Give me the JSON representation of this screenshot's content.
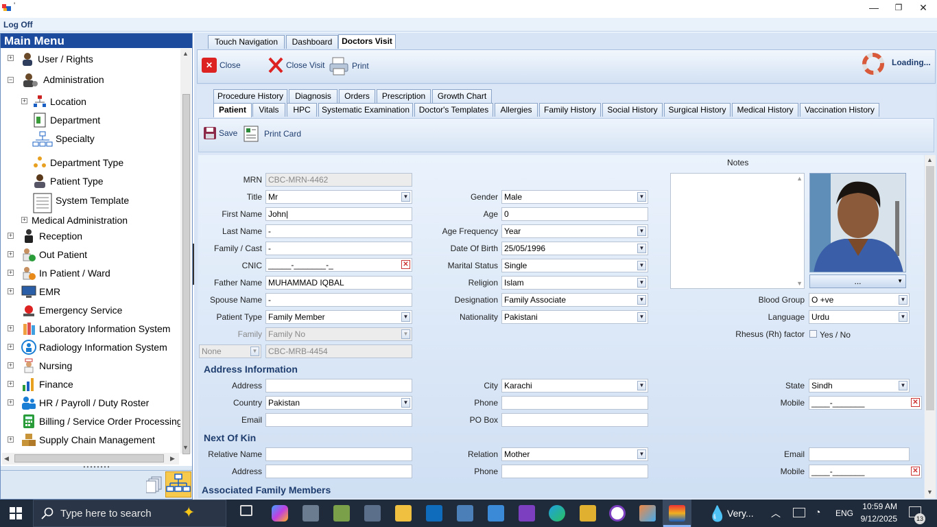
{
  "window": {
    "title": "'",
    "minimize": "—",
    "restore": "❐",
    "close": "✕"
  },
  "menubar": {
    "logoff": "Log Off"
  },
  "main_menu": {
    "header": "Main Menu",
    "items": [
      {
        "label": "User / Rights"
      },
      {
        "label": "Administration"
      },
      {
        "label": "Location"
      },
      {
        "label": "Department"
      },
      {
        "label": "Specialty"
      },
      {
        "label": "Department Type"
      },
      {
        "label": "Patient Type"
      },
      {
        "label": "System Template"
      },
      {
        "label": "Medical Administration"
      },
      {
        "label": "Reception"
      },
      {
        "label": "Out Patient"
      },
      {
        "label": "In Patient / Ward"
      },
      {
        "label": "EMR"
      },
      {
        "label": "Emergency Service"
      },
      {
        "label": "Laboratory Information System"
      },
      {
        "label": "Radiology Information System"
      },
      {
        "label": "Nursing"
      },
      {
        "label": "Finance"
      },
      {
        "label": "HR / Payroll / Duty Roster"
      },
      {
        "label": "Billing / Service Order Processing"
      },
      {
        "label": "Supply Chain Management"
      }
    ]
  },
  "top_tabs": [
    "Touch Navigation",
    "Dashboard",
    "Doctors Visit"
  ],
  "toolbar": {
    "close": "Close",
    "close_visit": "Close Visit",
    "print": "Print",
    "loading": "Loading..."
  },
  "sub_tabs_row1": [
    "Procedure History",
    "Diagnosis",
    "Orders",
    "Prescription",
    "Growth Chart"
  ],
  "sub_tabs_row2": [
    "Patient",
    "Vitals",
    "HPC",
    "Systematic Examination",
    "Doctor's Templates",
    "Allergies",
    "Family History",
    "Social History",
    "Surgical History",
    "Medical History",
    "Vaccination History"
  ],
  "patient_toolbar": {
    "save": "Save",
    "print_card": "Print Card"
  },
  "form": {
    "mrn": {
      "label": "MRN",
      "value": "CBC-MRN-4462"
    },
    "title": {
      "label": "Title",
      "value": "Mr"
    },
    "first_name": {
      "label": "First Name",
      "value": "John|"
    },
    "last_name": {
      "label": "Last Name",
      "value": "-"
    },
    "family_cast": {
      "label": "Family / Cast",
      "value": "-"
    },
    "cnic": {
      "label": "CNIC",
      "value": "_____-_______-_"
    },
    "father_name": {
      "label": "Father Name",
      "value": "MUHAMMAD IQBAL"
    },
    "spouse_name": {
      "label": "Spouse Name",
      "value": "-"
    },
    "patient_type": {
      "label": "Patient Type",
      "value": "Family Member"
    },
    "family": {
      "label": "Family",
      "value": "Family No"
    },
    "none_select": {
      "value": "None"
    },
    "mrb": {
      "value": "CBC-MRB-4454"
    },
    "gender": {
      "label": "Gender",
      "value": "Male"
    },
    "age": {
      "label": "Age",
      "value": "0"
    },
    "age_frequency": {
      "label": "Age Frequency",
      "value": "Year"
    },
    "dob": {
      "label": "Date Of Birth",
      "value": "25/05/1996"
    },
    "marital_status": {
      "label": "Marital Status",
      "value": "Single"
    },
    "religion": {
      "label": "Religion",
      "value": "Islam"
    },
    "designation": {
      "label": "Designation",
      "value": "Family Associate"
    },
    "nationality": {
      "label": "Nationality",
      "value": "Pakistani"
    },
    "notes": {
      "label": "Notes"
    },
    "photo_dropdown": {
      "value": "..."
    },
    "blood_group": {
      "label": "Blood Group",
      "value": "O +ve"
    },
    "language": {
      "label": "Language",
      "value": "Urdu"
    },
    "rhesus": {
      "label": "Rhesus (Rh) factor",
      "check_label": "Yes / No"
    }
  },
  "address": {
    "section": "Address Information",
    "address": {
      "label": "Address",
      "value": ""
    },
    "country": {
      "label": "Country",
      "value": "Pakistan"
    },
    "email": {
      "label": "Email",
      "value": ""
    },
    "city": {
      "label": "City",
      "value": "Karachi"
    },
    "phone": {
      "label": "Phone",
      "value": ""
    },
    "po_box": {
      "label": "PO Box",
      "value": ""
    },
    "state": {
      "label": "State",
      "value": "Sindh"
    },
    "mobile": {
      "label": "Mobile",
      "value": "____-_______"
    }
  },
  "next_of_kin": {
    "section": "Next Of Kin",
    "relative_name": {
      "label": "Relative Name",
      "value": ""
    },
    "address": {
      "label": "Address",
      "value": ""
    },
    "relation": {
      "label": "Relation",
      "value": "Mother"
    },
    "phone": {
      "label": "Phone",
      "value": ""
    },
    "email": {
      "label": "Email",
      "value": ""
    },
    "mobile": {
      "label": "Mobile",
      "value": "____-_______"
    }
  },
  "associated": {
    "section": "Associated Family Members"
  },
  "taskbar": {
    "search_placeholder": "Type here to search",
    "weather": "Very...",
    "lang": "ENG",
    "time": "10:59 AM",
    "date": "9/12/2025",
    "notif_count": "13"
  }
}
